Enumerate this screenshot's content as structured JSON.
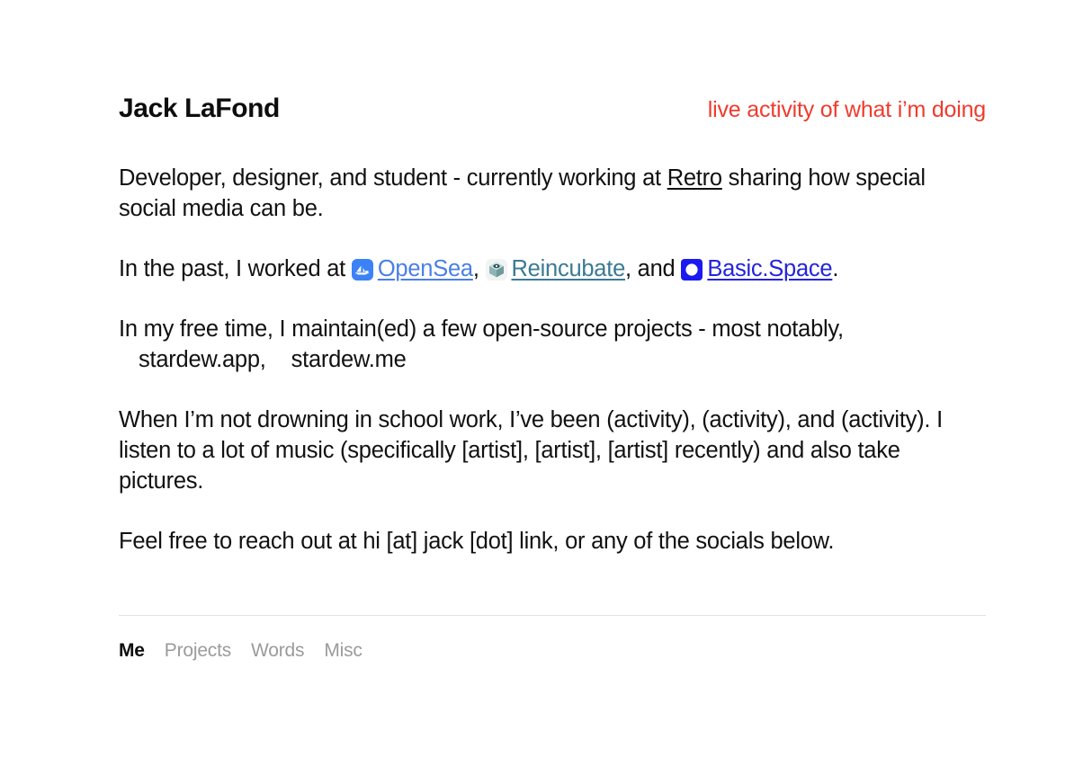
{
  "header": {
    "name": "Jack LaFond",
    "live_activity": "live activity of what i’m doing",
    "live_activity_color": "#ef3b2d"
  },
  "paragraphs": {
    "p1": {
      "before_link": "Developer, designer, and student - currently working at ",
      "link_label": "Retro",
      "after_link": " sharing how special social media can be."
    },
    "p2": {
      "intro": "In the past, I worked at ",
      "links": [
        {
          "label": "OpenSea",
          "color": "#4a7fe8",
          "icon": "opensea-icon",
          "separator": ", "
        },
        {
          "label": "Reincubate",
          "color": "#3a7a93",
          "icon": "reincubate-icon",
          "separator": ", and "
        },
        {
          "label": "Basic.Space",
          "color": "#2323dd",
          "icon": "basicspace-icon",
          "separator": "."
        }
      ]
    },
    "p3": {
      "intro": "In my free time, I maintain(ed) a few open-source projects - most notably,",
      "project_one": "stardew.app,",
      "project_two": "stardew.me"
    },
    "p4": "When I’m not drowning in school work, I’ve been (activity), (activity), and (activity). I listen to a lot of music (specifically [artist], [artist], [artist] recently) and also take pictures.",
    "p5": "Feel free to reach out at hi [at] jack [dot] link, or any of the socials below."
  },
  "footer": {
    "nav": [
      {
        "label": "Me",
        "active": true
      },
      {
        "label": "Projects",
        "active": false
      },
      {
        "label": "Words",
        "active": false
      },
      {
        "label": "Misc",
        "active": false
      }
    ]
  }
}
